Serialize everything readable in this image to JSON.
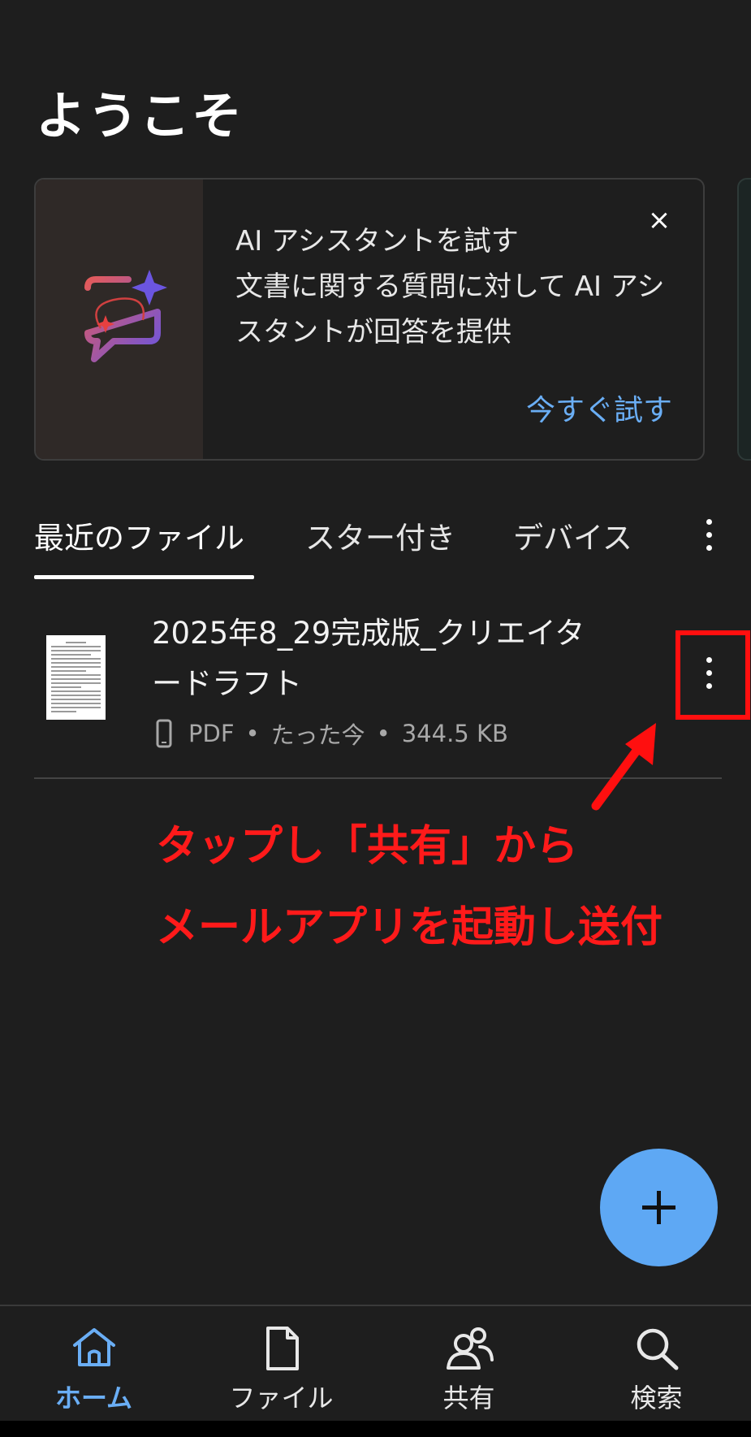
{
  "header": {
    "title": "ようこそ"
  },
  "promo": {
    "heading": "AI アシスタントを試す",
    "body": "文書に関する質問に対して AI アシスタントが回答を提供",
    "close": "×",
    "cta": "今すぐ試す"
  },
  "tabs": [
    {
      "label": "最近のファイル",
      "selected": true
    },
    {
      "label": "スター付き",
      "selected": false
    },
    {
      "label": "デバイス",
      "selected": false
    }
  ],
  "files": [
    {
      "name": "2025年8_29完成版_クリエイタードラフト",
      "type": "PDF",
      "modified": "たった今",
      "size": "344.5 KB",
      "separator": "•",
      "location_icon": "phone-icon"
    }
  ],
  "annotation": {
    "line1": "タップし「共有」から",
    "line2": "メールアプリを起動し送付",
    "color": "#ff1a1a"
  },
  "bottom_nav": [
    {
      "label": "ホーム",
      "icon": "home-icon",
      "active": true
    },
    {
      "label": "ファイル",
      "icon": "file-icon",
      "active": false
    },
    {
      "label": "共有",
      "icon": "shared-people-icon",
      "active": false
    },
    {
      "label": "検索",
      "icon": "search-icon",
      "active": false
    }
  ],
  "colors": {
    "background": "#1e1e1e",
    "accent": "#6aaef5",
    "fab": "#5ea8f4",
    "annotation": "#ff0f0f"
  }
}
